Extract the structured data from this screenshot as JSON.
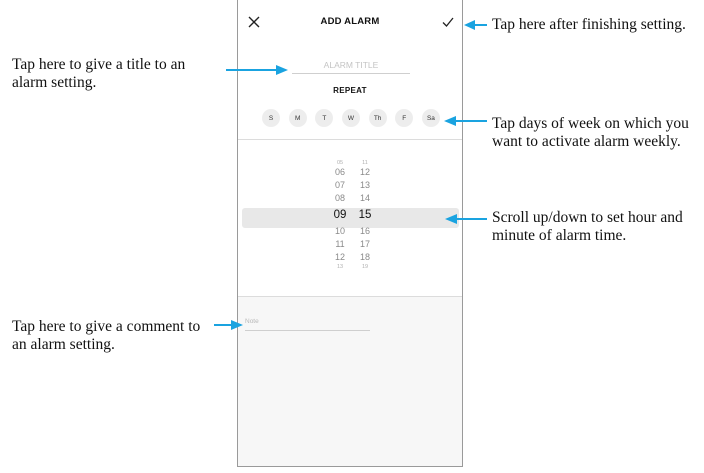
{
  "app": {
    "screen_title": "ADD ALARM",
    "close_icon": "close-icon",
    "confirm_icon": "check-icon"
  },
  "form": {
    "title_placeholder": "ALARM TITLE",
    "repeat_label": "REPEAT",
    "days": [
      "S",
      "M",
      "T",
      "W",
      "Th",
      "F",
      "Sa"
    ],
    "note_placeholder": "Note"
  },
  "picker": {
    "hours": {
      "above_tiny": "05",
      "above": [
        "06",
        "07",
        "08"
      ],
      "selected": "09",
      "below": [
        "10",
        "11",
        "12"
      ],
      "below_tiny": "13"
    },
    "minutes": {
      "above_tiny": "11",
      "above": [
        "12",
        "13",
        "14"
      ],
      "selected": "15",
      "below": [
        "16",
        "17",
        "18"
      ],
      "below_tiny": "19"
    }
  },
  "annotations": {
    "confirm": "Tap here after finishing setting.",
    "title": "Tap here to give a title to an alarm setting.",
    "days": "Tap days of week on which you want to activate alarm weekly.",
    "scroll": "Scroll up/down to set hour and minute of alarm time.",
    "note": "Tap here to give a comment to an alarm setting."
  },
  "colors": {
    "arrow": "#1aa3e0",
    "highlight_band": "#e8e8e8",
    "day_circle": "#ededed"
  }
}
